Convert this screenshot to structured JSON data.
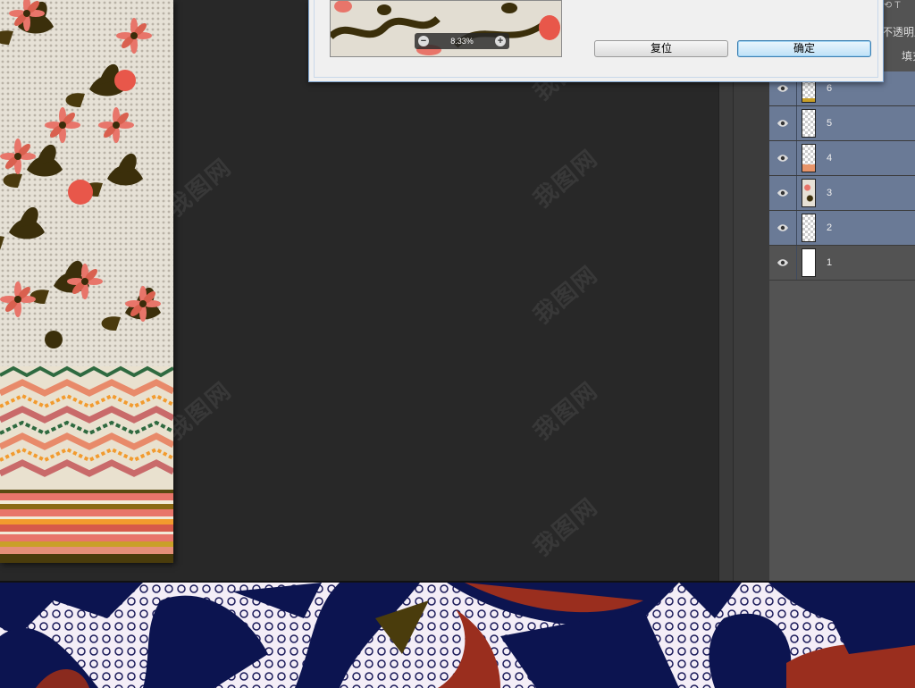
{
  "dialog": {
    "zoom_label": "8.33%",
    "zoom_out_icon": "minus-circle-icon",
    "zoom_in_icon": "plus-circle-icon",
    "reset_label": "复位",
    "ok_label": "确定"
  },
  "panel_top": {
    "opacity_label": "不透明度",
    "fill_label": "填充",
    "text_tool_glyph": "T"
  },
  "layers": [
    {
      "name": "6",
      "selected": true,
      "thumb": "checker-strip"
    },
    {
      "name": "5",
      "selected": true,
      "thumb": "checker-pattern"
    },
    {
      "name": "4",
      "selected": true,
      "thumb": "checker-orange"
    },
    {
      "name": "3",
      "selected": true,
      "thumb": "floral"
    },
    {
      "name": "2",
      "selected": true,
      "thumb": "checker-dots"
    },
    {
      "name": "1",
      "selected": false,
      "thumb": "white"
    }
  ],
  "watermark_text": "我图网"
}
